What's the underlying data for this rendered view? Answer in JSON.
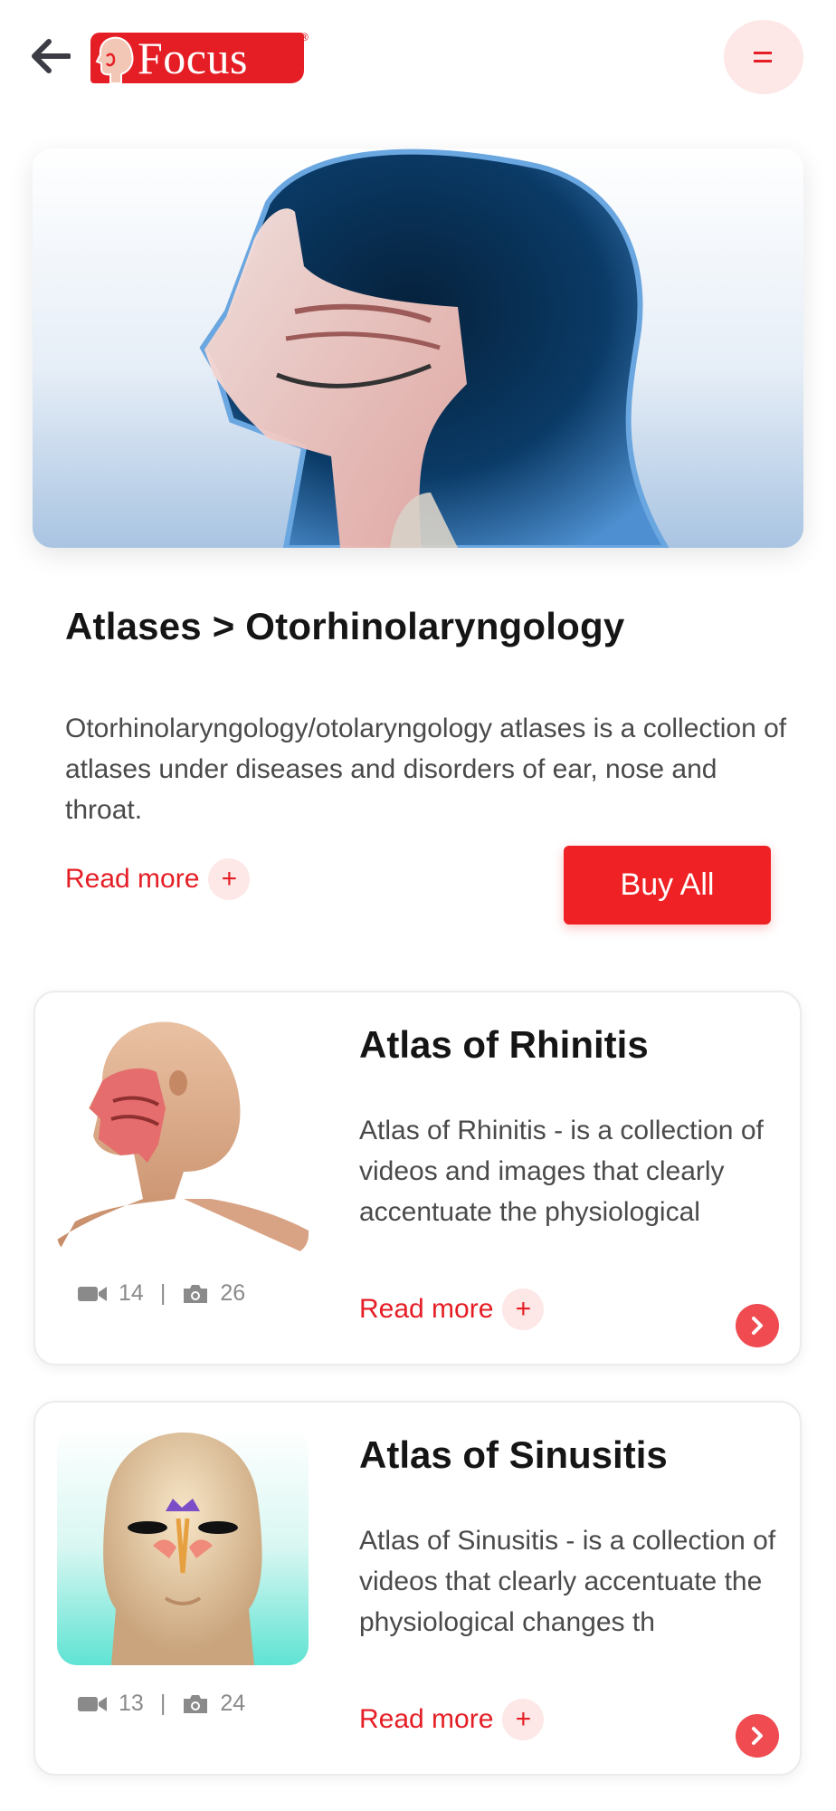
{
  "header": {
    "logo_text": "Focus",
    "logo_reg": "®",
    "menu_glyph": "="
  },
  "intro": {
    "breadcrumb": "Atlases > Otorhinolaryngology",
    "description": "Otorhinolaryngology/otolaryngology atlases is a collection of atlases under diseases and disorders of ear, nose and throat.",
    "read_more": "Read more",
    "plus": "+",
    "buy_all": "Buy All"
  },
  "atlases": [
    {
      "title": "Atlas of Rhinitis",
      "description": "Atlas of Rhinitis - is a collection of videos and images that clearly accentuate the physiological",
      "videos": "14",
      "separator": "|",
      "images": "26",
      "read_more": "Read more",
      "plus": "+"
    },
    {
      "title": "Atlas of Sinusitis",
      "description": "Atlas of Sinusitis - is a collection of videos that clearly accentuate the physiological changes th",
      "videos": "13",
      "separator": "|",
      "images": "24",
      "read_more": "Read more",
      "plus": "+"
    }
  ],
  "icons": {
    "back": "arrow-left-icon",
    "menu": "menu-icon",
    "video": "video-camera-icon",
    "camera": "camera-icon",
    "go": "chevron-right-icon"
  },
  "colors": {
    "accent": "#e51e25",
    "button": "#ef2124",
    "soft_accent": "#fde7e7",
    "text": "#151515",
    "muted": "#4a4a4a"
  }
}
